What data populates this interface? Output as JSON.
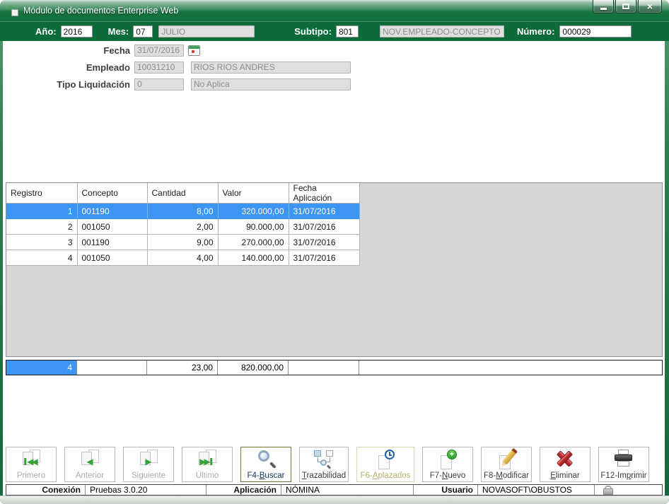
{
  "window": {
    "title": "Módulo de documentos Enterprise Web"
  },
  "icons": {
    "close": "×",
    "first_arrows": "◀◀",
    "prev_arrow": "◀",
    "next_arrow": "▶",
    "last_arrows": "▶▶",
    "plus": "+"
  },
  "header": {
    "ano_label": "Año:",
    "ano_value": "2016",
    "mes_label": "Mes:",
    "mes_value": "07",
    "mes_name": "JULIO",
    "subtipo_label": "Subtipo:",
    "subtipo_value": "801",
    "subtipo_name": "NOV.EMPLEADO-CONCEPTO",
    "numero_label": "Número:",
    "numero_value": "000029"
  },
  "form": {
    "fecha_label": "Fecha",
    "fecha_value": "31/07/2016",
    "empleado_label": "Empleado",
    "empleado_code": "10031210",
    "empleado_name": "RIOS RIOS ANDRES",
    "tipo_label": "Tipo Liquidación",
    "tipo_code": "0",
    "tipo_name": "No Aplica"
  },
  "grid": {
    "columns": [
      "Registro",
      "Concepto",
      "Cantidad",
      "Valor",
      "Fecha Aplicación"
    ],
    "rows": [
      [
        "1",
        "001190",
        "8,00",
        "320.000,00",
        "31/07/2016"
      ],
      [
        "2",
        "001050",
        "2,00",
        "90.000,00",
        "31/07/2016"
      ],
      [
        "3",
        "001190",
        "9,00",
        "270.000,00",
        "31/07/2016"
      ],
      [
        "4",
        "001050",
        "4,00",
        "140.000,00",
        "31/07/2016"
      ]
    ],
    "selected_row_index": 0,
    "summary": {
      "registro": "4",
      "concepto": "",
      "cantidad": "23,00",
      "valor": "820.000,00",
      "fecha": "",
      "extra": ""
    }
  },
  "toolbar": {
    "buttons": [
      {
        "pre": "Primero",
        "key": "",
        "post": "",
        "state": "disabled"
      },
      {
        "pre": "Anterior",
        "key": "",
        "post": "",
        "state": "disabled"
      },
      {
        "pre": "Siguiente",
        "key": "",
        "post": "",
        "state": "disabled"
      },
      {
        "pre": "Último",
        "key": "",
        "post": "",
        "state": "disabled"
      },
      {
        "pre": "F4-",
        "key": "B",
        "post": "uscar",
        "state": "focused"
      },
      {
        "pre": "",
        "key": "T",
        "post": "razabilidad",
        "state": "normal"
      },
      {
        "pre": "F6-",
        "key": "A",
        "post": "plazados",
        "state": "olive"
      },
      {
        "pre": "F7-",
        "key": "N",
        "post": "uevo",
        "state": "normal"
      },
      {
        "pre": "F8-",
        "key": "M",
        "post": "odificar",
        "state": "normal"
      },
      {
        "pre": "",
        "key": "E",
        "post": "liminar",
        "state": "normal"
      },
      {
        "pre": "F12-Im",
        "key": "p",
        "post": "rimir",
        "state": "normal"
      }
    ]
  },
  "statusbar": {
    "conexion_label": "Conexión",
    "conexion_value": "Pruebas 3.0.20",
    "aplicacion_label": "Aplicación",
    "aplicacion_value": "NÓMINA",
    "usuario_label": "Usuario",
    "usuario_value": "NOVASOFT\\OBUSTOS"
  },
  "colors": {
    "titlebar_green": "#0F6E3C",
    "fieldbar_green": "#0C6B39",
    "selection_blue": "#3D95F2",
    "grid_gray": "#D6D6D6",
    "buscar_text": "#17365D",
    "aplazados_text": "#B3AF6E"
  }
}
